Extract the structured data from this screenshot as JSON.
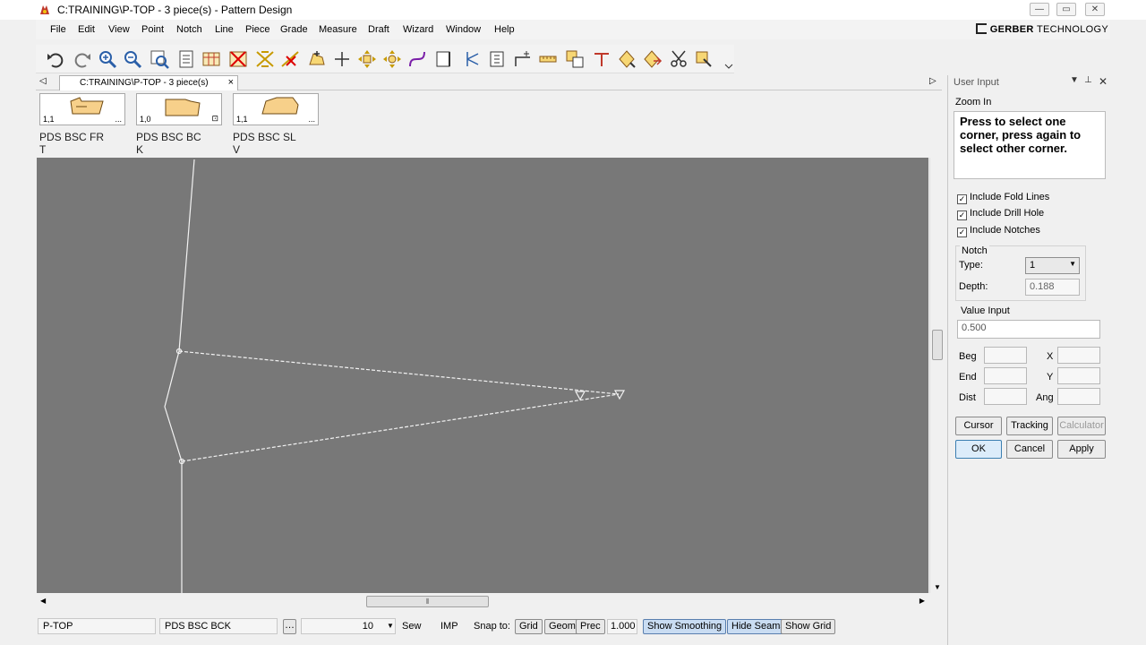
{
  "window": {
    "title": "C:TRAINING\\P-TOP  -  3 piece(s) - Pattern Design"
  },
  "menu": {
    "items": [
      "File",
      "Edit",
      "View",
      "Point",
      "Notch",
      "Line",
      "Piece",
      "Grade",
      "Measure",
      "Draft",
      "Wizard",
      "Window",
      "Help"
    ],
    "brand": "GERBER",
    "brand_suffix": "TECHNOLOGY"
  },
  "doc_tab": {
    "label": "C:TRAINING\\P-TOP  -  3 piece(s)",
    "close": "×"
  },
  "pieces": [
    {
      "num": "1,1",
      "more": "...",
      "label_line1": "PDS BSC FR",
      "label_line2": "T"
    },
    {
      "num": "1,0",
      "more": "⊡",
      "label_line1": "PDS BSC BC",
      "label_line2": "K"
    },
    {
      "num": "1,1",
      "more": "...",
      "label_line1": "PDS BSC SL",
      "label_line2": "V"
    }
  ],
  "statusbar": {
    "model": "P-TOP",
    "piece": "PDS BSC BCK",
    "count": "10",
    "sew": "Sew",
    "units": "IMP",
    "snap_label": "Snap to:",
    "grid": "Grid",
    "geom": "Geom",
    "prec": "Prec",
    "prec_value": "1.000",
    "show_smoothing": "Show Smoothing",
    "hide_seams": "Hide Seams",
    "show_grid": "Show Grid"
  },
  "panel": {
    "title": "User Input",
    "mode": "Zoom In",
    "prompt": "Press to select one corner, press again to select other corner.",
    "include_fold_lines": "Include Fold Lines",
    "include_drill_hole": "Include Drill Hole",
    "include_notches": "Include Notches",
    "notch_group": "Notch",
    "type_label": "Type:",
    "type_value": "1",
    "depth_label": "Depth:",
    "depth_value": "0.188",
    "value_input_label": "Value Input",
    "value_input": "0.500",
    "beg": "Beg",
    "end": "End",
    "dist": "Dist",
    "x": "X",
    "y": "Y",
    "ang": "Ang",
    "cursor": "Cursor",
    "tracking": "Tracking",
    "calculator": "Calculator",
    "ok": "OK",
    "cancel": "Cancel",
    "apply": "Apply"
  },
  "colors": {
    "canvas": "#787878",
    "line": "#f2f2f2",
    "accent": "#3c7fb1"
  }
}
